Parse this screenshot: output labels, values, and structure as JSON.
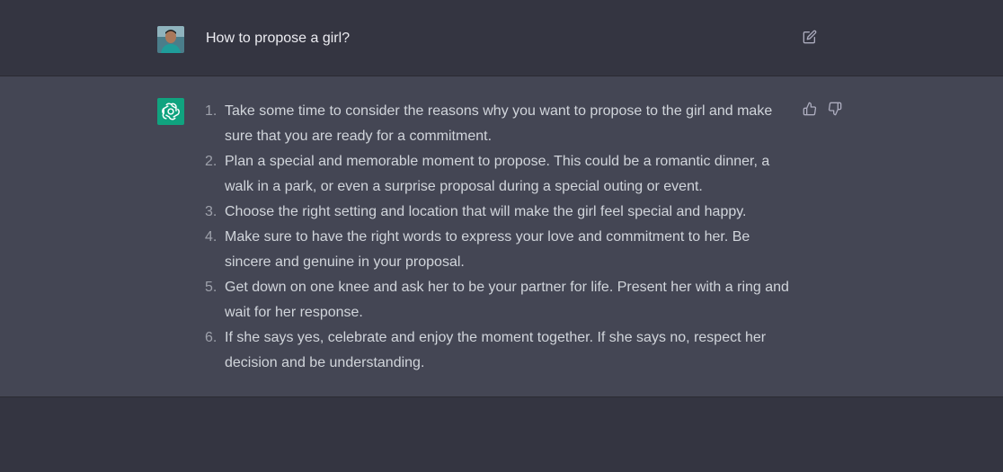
{
  "conversation": {
    "user_message": "How to propose a girl?",
    "answer_items": [
      {
        "num": "1.",
        "text": "Take some time to consider the reasons why you want to propose to the girl and make sure that you are ready for a commitment."
      },
      {
        "num": "2.",
        "text": "Plan a special and memorable moment to propose. This could be a romantic dinner, a walk in a park, or even a surprise proposal during a special outing or event."
      },
      {
        "num": "3.",
        "text": "Choose the right setting and location that will make the girl feel special and happy."
      },
      {
        "num": "4.",
        "text": "Make sure to have the right words to express your love and commitment to her. Be sincere and genuine in your proposal."
      },
      {
        "num": "5.",
        "text": "Get down on one knee and ask her to be your partner for life. Present her with a ring and wait for her response."
      },
      {
        "num": "6.",
        "text": "If she says yes, celebrate and enjoy the moment together. If she says no, respect her decision and be understanding."
      }
    ]
  },
  "icons": {
    "edit": "edit-icon",
    "thumbs_up": "thumbs-up-icon",
    "thumbs_down": "thumbs-down-icon",
    "assistant_logo": "openai-logo-icon"
  },
  "colors": {
    "background": "#343541",
    "response_background": "#444654",
    "assistant_avatar": "#10a37f",
    "text": "#d1d5db"
  }
}
